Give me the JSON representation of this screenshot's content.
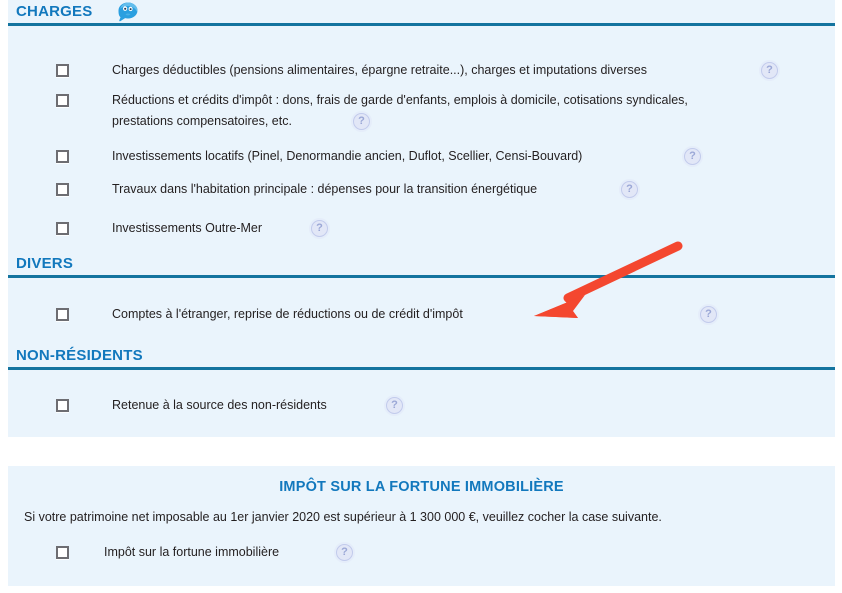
{
  "panels": {
    "main": {
      "sections": [
        {
          "id": "charges",
          "title": "CHARGES",
          "icon": "chat-bubble-mascot-icon",
          "rows": [
            {
              "label": "Charges déductibles (pensions alimentaires, épargne retraite...), charges et imputations diverses",
              "checked": false,
              "help": "?"
            },
            {
              "label": "Réductions et crédits d'impôt : dons, frais de garde d'enfants, emplois à domicile, cotisations syndicales,",
              "label2": "prestations compensatoires, etc.",
              "checked": false,
              "help": "?"
            },
            {
              "label": "Investissements locatifs (Pinel, Denormandie ancien, Duflot, Scellier, Censi-Bouvard)",
              "checked": false,
              "help": "?"
            },
            {
              "label": "Travaux dans l'habitation principale : dépenses pour la transition énergétique",
              "checked": false,
              "help": "?"
            },
            {
              "label": "Investissements Outre-Mer",
              "checked": false,
              "help": "?"
            }
          ]
        },
        {
          "id": "divers",
          "title": "DIVERS",
          "rows": [
            {
              "label": "Comptes à l'étranger, reprise de réductions ou de crédit d'impôt",
              "checked": false,
              "help": "?"
            }
          ]
        },
        {
          "id": "non-residents",
          "title": "NON-RÉSIDENTS",
          "rows": [
            {
              "label": "Retenue à la source des non-résidents",
              "checked": false,
              "help": "?"
            }
          ]
        }
      ]
    },
    "ifi": {
      "title": "IMPÔT SUR LA FORTUNE IMMOBILIÈRE",
      "note": "Si votre patrimoine net imposable au 1er janvier 2020 est supérieur à 1 300 000 €, veuillez cocher la case suivante.",
      "row": {
        "label": "Impôt sur la fortune immobilière",
        "checked": false,
        "help": "?"
      }
    }
  },
  "annotation": {
    "type": "arrow",
    "color": "#f4472f",
    "points_to": "Comptes à l'étranger, reprise de réductions ou de crédit d'impôt"
  },
  "colors": {
    "panel_background": "#eaf4fc",
    "heading_blue": "#1278bd",
    "rule_blue": "#14749f",
    "text": "#231f20",
    "checkbox_border": "#6d6d72",
    "help_icon": "#c2cbec",
    "arrow_red": "#f4472f"
  }
}
